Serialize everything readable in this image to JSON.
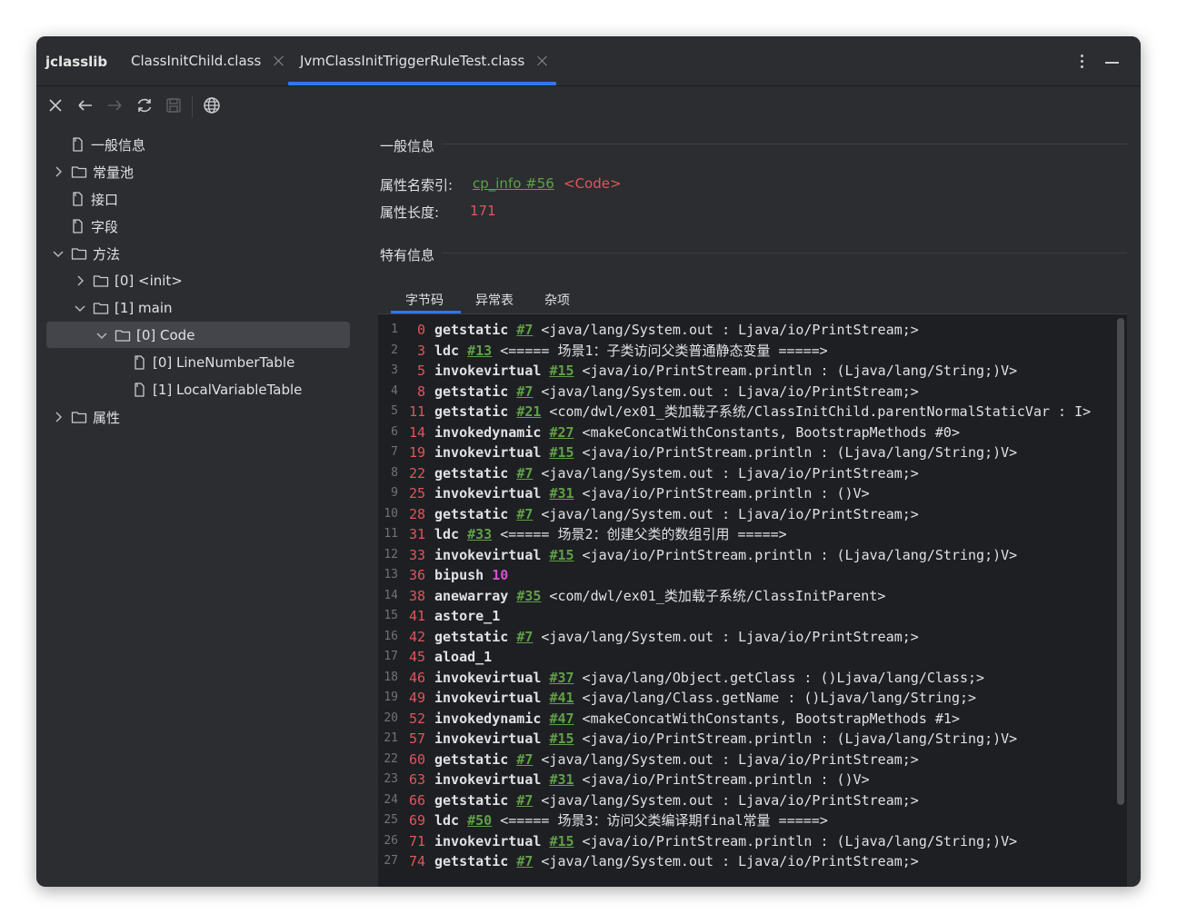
{
  "app": {
    "name": "jclasslib"
  },
  "tabs": [
    {
      "label": "ClassInitChild.class",
      "active": false
    },
    {
      "label": "JvmClassInitTriggerRuleTest.class",
      "active": true
    }
  ],
  "toolbar": {
    "icons": [
      "close-icon",
      "back-arrow-icon",
      "forward-arrow-icon",
      "refresh-icon",
      "save-icon",
      "globe-icon"
    ]
  },
  "tree": {
    "items": [
      {
        "label": "一般信息",
        "icon": "file-icon"
      },
      {
        "label": "常量池",
        "icon": "folder-icon",
        "expand": "collapsed"
      },
      {
        "label": "接口",
        "icon": "file-icon"
      },
      {
        "label": "字段",
        "icon": "file-icon"
      },
      {
        "label": "方法",
        "icon": "folder-icon",
        "expand": "expanded"
      },
      {
        "label": "[0] <init>",
        "icon": "folder-icon",
        "expand": "collapsed"
      },
      {
        "label": "[1] main",
        "icon": "folder-icon",
        "expand": "expanded"
      },
      {
        "label": "[0] Code",
        "icon": "folder-icon",
        "expand": "expanded",
        "selected": true
      },
      {
        "label": "[0] LineNumberTable",
        "icon": "file-icon"
      },
      {
        "label": "[1] LocalVariableTable",
        "icon": "file-icon"
      },
      {
        "label": "属性",
        "icon": "folder-icon",
        "expand": "collapsed"
      }
    ]
  },
  "general": {
    "section_title": "一般信息",
    "attr_name_label": "属性名索引:",
    "attr_name_link": "cp_info #56",
    "attr_name_value": "<Code>",
    "attr_len_label": "属性长度:",
    "attr_len_value": "171"
  },
  "specific": {
    "section_title": "特有信息"
  },
  "subtabs": [
    {
      "label": "字节码",
      "active": true
    },
    {
      "label": "异常表",
      "active": false
    },
    {
      "label": "杂项",
      "active": false
    }
  ],
  "bytecode": [
    {
      "ln": "1",
      "off": "0",
      "op": "getstatic",
      "ref": "#7",
      "arg": " <java/lang/System.out : Ljava/io/PrintStream;>"
    },
    {
      "ln": "2",
      "off": "3",
      "op": "ldc",
      "ref": "#13",
      "arg": " <===== 场景1：子类访问父类普通静态变量 =====>"
    },
    {
      "ln": "3",
      "off": "5",
      "op": "invokevirtual",
      "ref": "#15",
      "arg": " <java/io/PrintStream.println : (Ljava/lang/String;)V>"
    },
    {
      "ln": "4",
      "off": "8",
      "op": "getstatic",
      "ref": "#7",
      "arg": " <java/lang/System.out : Ljava/io/PrintStream;>"
    },
    {
      "ln": "5",
      "off": "11",
      "op": "getstatic",
      "ref": "#21",
      "arg": " <com/dwl/ex01_类加载子系统/ClassInitChild.parentNormalStaticVar : I>"
    },
    {
      "ln": "6",
      "off": "14",
      "op": "invokedynamic",
      "ref": "#27",
      "arg": " <makeConcatWithConstants, BootstrapMethods #0>"
    },
    {
      "ln": "7",
      "off": "19",
      "op": "invokevirtual",
      "ref": "#15",
      "arg": " <java/io/PrintStream.println : (Ljava/lang/String;)V>"
    },
    {
      "ln": "8",
      "off": "22",
      "op": "getstatic",
      "ref": "#7",
      "arg": " <java/lang/System.out : Ljava/io/PrintStream;>"
    },
    {
      "ln": "9",
      "off": "25",
      "op": "invokevirtual",
      "ref": "#31",
      "arg": " <java/io/PrintStream.println : ()V>"
    },
    {
      "ln": "10",
      "off": "28",
      "op": "getstatic",
      "ref": "#7",
      "arg": " <java/lang/System.out : Ljava/io/PrintStream;>"
    },
    {
      "ln": "11",
      "off": "31",
      "op": "ldc",
      "ref": "#33",
      "arg": " <===== 场景2：创建父类的数组引用 =====>"
    },
    {
      "ln": "12",
      "off": "33",
      "op": "invokevirtual",
      "ref": "#15",
      "arg": " <java/io/PrintStream.println : (Ljava/lang/String;)V>"
    },
    {
      "ln": "13",
      "off": "36",
      "op": "bipush",
      "num": "10"
    },
    {
      "ln": "14",
      "off": "38",
      "op": "anewarray",
      "ref": "#35",
      "arg": " <com/dwl/ex01_类加载子系统/ClassInitParent>"
    },
    {
      "ln": "15",
      "off": "41",
      "op": "astore_1"
    },
    {
      "ln": "16",
      "off": "42",
      "op": "getstatic",
      "ref": "#7",
      "arg": " <java/lang/System.out : Ljava/io/PrintStream;>"
    },
    {
      "ln": "17",
      "off": "45",
      "op": "aload_1"
    },
    {
      "ln": "18",
      "off": "46",
      "op": "invokevirtual",
      "ref": "#37",
      "arg": " <java/lang/Object.getClass : ()Ljava/lang/Class;>"
    },
    {
      "ln": "19",
      "off": "49",
      "op": "invokevirtual",
      "ref": "#41",
      "arg": " <java/lang/Class.getName : ()Ljava/lang/String;>"
    },
    {
      "ln": "20",
      "off": "52",
      "op": "invokedynamic",
      "ref": "#47",
      "arg": " <makeConcatWithConstants, BootstrapMethods #1>"
    },
    {
      "ln": "21",
      "off": "57",
      "op": "invokevirtual",
      "ref": "#15",
      "arg": " <java/io/PrintStream.println : (Ljava/lang/String;)V>"
    },
    {
      "ln": "22",
      "off": "60",
      "op": "getstatic",
      "ref": "#7",
      "arg": " <java/lang/System.out : Ljava/io/PrintStream;>"
    },
    {
      "ln": "23",
      "off": "63",
      "op": "invokevirtual",
      "ref": "#31",
      "arg": " <java/io/PrintStream.println : ()V>"
    },
    {
      "ln": "24",
      "off": "66",
      "op": "getstatic",
      "ref": "#7",
      "arg": " <java/lang/System.out : Ljava/io/PrintStream;>"
    },
    {
      "ln": "25",
      "off": "69",
      "op": "ldc",
      "ref": "#50",
      "arg": " <===== 场景3：访问父类编译期final常量 =====>"
    },
    {
      "ln": "26",
      "off": "71",
      "op": "invokevirtual",
      "ref": "#15",
      "arg": " <java/io/PrintStream.println : (Ljava/lang/String;)V>"
    },
    {
      "ln": "27",
      "off": "74",
      "op": "getstatic",
      "ref": "#7",
      "arg": " <java/lang/System.out : Ljava/io/PrintStream;>"
    }
  ],
  "colors": {
    "accent": "#3574f0",
    "offset": "#e0565b",
    "link": "#5fa047",
    "number": "#d44fd4",
    "panel": "#2b2d30",
    "editor": "#1e1f22"
  }
}
